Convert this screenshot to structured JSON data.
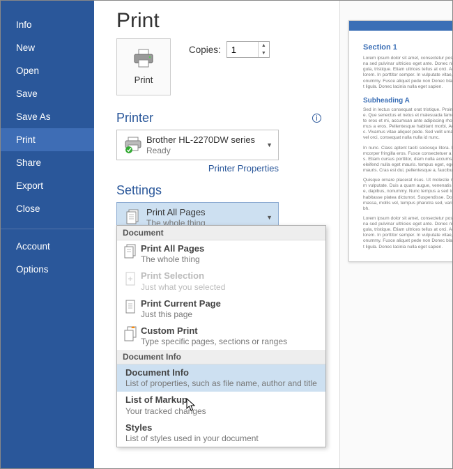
{
  "sidebar": {
    "items": [
      {
        "label": "Info"
      },
      {
        "label": "New"
      },
      {
        "label": "Open"
      },
      {
        "label": "Save"
      },
      {
        "label": "Save As"
      },
      {
        "label": "Print",
        "selected": true
      },
      {
        "label": "Share"
      },
      {
        "label": "Export"
      },
      {
        "label": "Close"
      }
    ],
    "footer": [
      {
        "label": "Account"
      },
      {
        "label": "Options"
      }
    ]
  },
  "main": {
    "title": "Print",
    "printButton": "Print",
    "copies": {
      "label": "Copies:",
      "value": "1"
    },
    "printerHeader": "Printer",
    "printer": {
      "name": "Brother HL-2270DW series",
      "status": "Ready"
    },
    "printerProperties": "Printer Properties",
    "settingsHeader": "Settings",
    "settingsSelector": {
      "title": "Print All Pages",
      "sub": "The whole thing"
    }
  },
  "dropdown": {
    "groupDocument": "Document",
    "groupDocumentInfo": "Document Info",
    "items": [
      {
        "title": "Print All Pages",
        "sub": "The whole thing"
      },
      {
        "title": "Print Selection",
        "sub": "Just what you selected",
        "disabled": true
      },
      {
        "title": "Print Current Page",
        "sub": "Just this page"
      },
      {
        "title": "Custom Print",
        "sub": "Type specific pages, sections or ranges"
      }
    ],
    "infoItems": [
      {
        "title": "Document Info",
        "sub": "List of properties, such as file name, author and title",
        "hover": true
      },
      {
        "title": "List of Markup",
        "sub": "Your tracked changes"
      },
      {
        "title": "Styles",
        "sub": "List of styles used in your document"
      }
    ]
  },
  "preview": {
    "section1": "Section 1",
    "subA": "Subheading A",
    "para": "Lorem ipsum dolor sit amet, consectetur posuere, magna sed pulvinar ultricies eget ante. Donec nisl varius ligula, tristique. Etiam ultrices tellus at orci. Aenean nec lorem. In porttitor semper. In vulputate vitae, pretium nonummy. Fusce aliquet pede non Donec blandit feugiat ligula. Donec lacinia nulla eget sapien.",
    "para2": "Sed in lectus consequat orat tristique. Proin nec augue. Que senectus et netus et malesuada fames. vulputate eros et mi, accumsan ante adipiscing rhoncus. Vivamus a eros. Pellentesque habitant morbi, Aenean nunc. Vivamus vitae aliquet pede. Sed velit urna, interdum vel orci, consequat nulla nulla id nunc.",
    "para3": "In nunc. Class aptent taciti sociosqu litora. Donec ullamcorper fringilla eros. Fusce consectetuer a ipsum risus. Etiam cursus porttitor, diam nulla accumsan. Mauris eleifend nulla eget mauris. tempus eget, egestas quis, mauris. Cras est dui, pellentesque a, faucibus.",
    "para4": "Quisque ornare placerat risus. Ut molestie magna. Nam vulputate. Duis a quam augue, venenatis scelerisque, dapibus, nonummy. Nunc tempus a sed lobortis hac habitasse platea dictumst. Suspendisse. Donec metus massa, mollis vel, tempus pharetra sed, varius eget, nibh."
  }
}
